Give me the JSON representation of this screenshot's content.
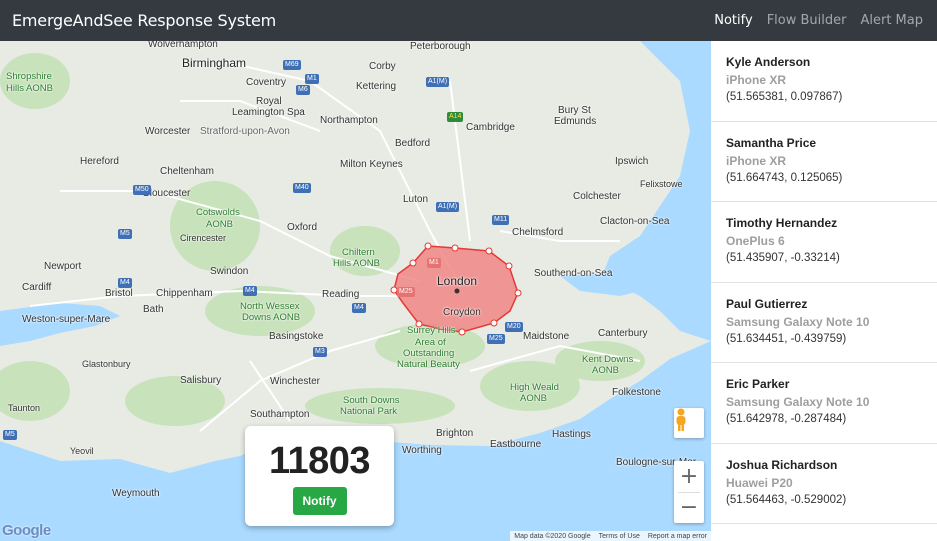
{
  "navbar": {
    "brand": "EmergeAndSee Response System",
    "links": [
      {
        "label": "Notify",
        "active": true
      },
      {
        "label": "Flow Builder",
        "active": false
      },
      {
        "label": "Alert Map",
        "active": false
      }
    ]
  },
  "map": {
    "cities": {
      "wolverhampton": "Wolverhampton",
      "birmingham": "Birmingham",
      "peterborough": "Peterborough",
      "shropshire": "Shropshire",
      "hills_aonb": "Hills AONB",
      "coventry": "Coventry",
      "corby": "Corby",
      "kettering": "Kettering",
      "royal_leamington": "Royal",
      "leamington_spa": "Leamington Spa",
      "bury": "Bury St",
      "edmunds": "Edmunds",
      "stratford": "Stratford-upon-Avon",
      "worcester": "Worcester",
      "northampton": "Northampton",
      "cambridge": "Cambridge",
      "bedford": "Bedford",
      "hereford": "Hereford",
      "ipswich": "Ipswich",
      "milton_keynes": "Milton Keynes",
      "felixstowe": "Felixstowe",
      "cheltenham": "Cheltenham",
      "gloucester": "Gloucester",
      "cotswolds": "Cotswolds",
      "aonb1": "AONB",
      "luton": "Luton",
      "colchester": "Colchester",
      "cirencester": "Cirencester",
      "clacton": "Clacton-on-Sea",
      "oxford": "Oxford",
      "chelmsford": "Chelmsford",
      "chiltern": "Chiltern",
      "hills_aonb2": "Hills AONB",
      "newport": "Newport",
      "swindon": "Swindon",
      "london": "London",
      "southend": "Southend-on-Sea",
      "cardiff": "Cardiff",
      "bristol": "Bristol",
      "chippenham": "Chippenham",
      "reading": "Reading",
      "north_wessex": "North Wessex",
      "downs_aonb": "Downs AONB",
      "croydon": "Croydon",
      "weston": "Weston-super-Mare",
      "bath": "Bath",
      "canterbury": "Canterbury",
      "basingstoke": "Basingstoke",
      "surrey_hills": "Surrey Hills",
      "area_of": "Area of",
      "outstanding": "Outstanding",
      "natural_beauty": "Natural Beauty",
      "maidstone": "Maidstone",
      "glastonbury": "Glastonbury",
      "kent_downs": "Kent Downs",
      "aonb2": "AONB",
      "salisbury": "Salisbury",
      "winchester": "Winchester",
      "high_weald": "High Weald",
      "aonb3": "AONB",
      "folkestone": "Folkestone",
      "south_downs": "South Downs",
      "national_park": "National Park",
      "southampton": "Southampton",
      "brighton": "Brighton",
      "hastings": "Hastings",
      "worthing": "Worthing",
      "eastbourne": "Eastbourne",
      "boulogne": "Boulogne-sur-Mer",
      "weymouth": "Weymouth",
      "yeovil": "Yeovil",
      "taunton": "Taunton"
    },
    "roads": [
      "M69",
      "M1",
      "M6",
      "A1(M)",
      "A14",
      "M50",
      "M40",
      "A1(M)",
      "M11",
      "M4",
      "M4",
      "M1",
      "M25",
      "M4",
      "M3",
      "M20",
      "M25",
      "M5",
      "M5"
    ],
    "attribution": [
      "Map data ©2020 Google",
      "Terms of Use",
      "Report a map error"
    ],
    "logo": "Google",
    "zoom_in": "+",
    "zoom_out": "−"
  },
  "counter": {
    "value": "11803",
    "button_label": "Notify"
  },
  "recipients": [
    {
      "name": "Kyle Anderson",
      "device": "iPhone XR",
      "coords": "(51.565381, 0.097867)"
    },
    {
      "name": "Samantha Price",
      "device": "iPhone XR",
      "coords": "(51.664743, 0.125065)"
    },
    {
      "name": "Timothy Hernandez",
      "device": "OnePlus 6",
      "coords": "(51.435907, -0.33214)"
    },
    {
      "name": "Paul Gutierrez",
      "device": "Samsung Galaxy Note 10",
      "coords": "(51.634451, -0.439759)"
    },
    {
      "name": "Eric Parker",
      "device": "Samsung Galaxy Note 10",
      "coords": "(51.642978, -0.287484)"
    },
    {
      "name": "Joshua Richardson",
      "device": "Huawei P20",
      "coords": "(51.564463, -0.529002)"
    }
  ],
  "colors": {
    "navbar": "#343a40",
    "notify_button": "#28a745",
    "polygon_fill": "#f08080",
    "polygon_stroke": "#e53935",
    "sea": "#aadaff",
    "land": "#e8ebe4",
    "park": "#b7d8a8"
  }
}
